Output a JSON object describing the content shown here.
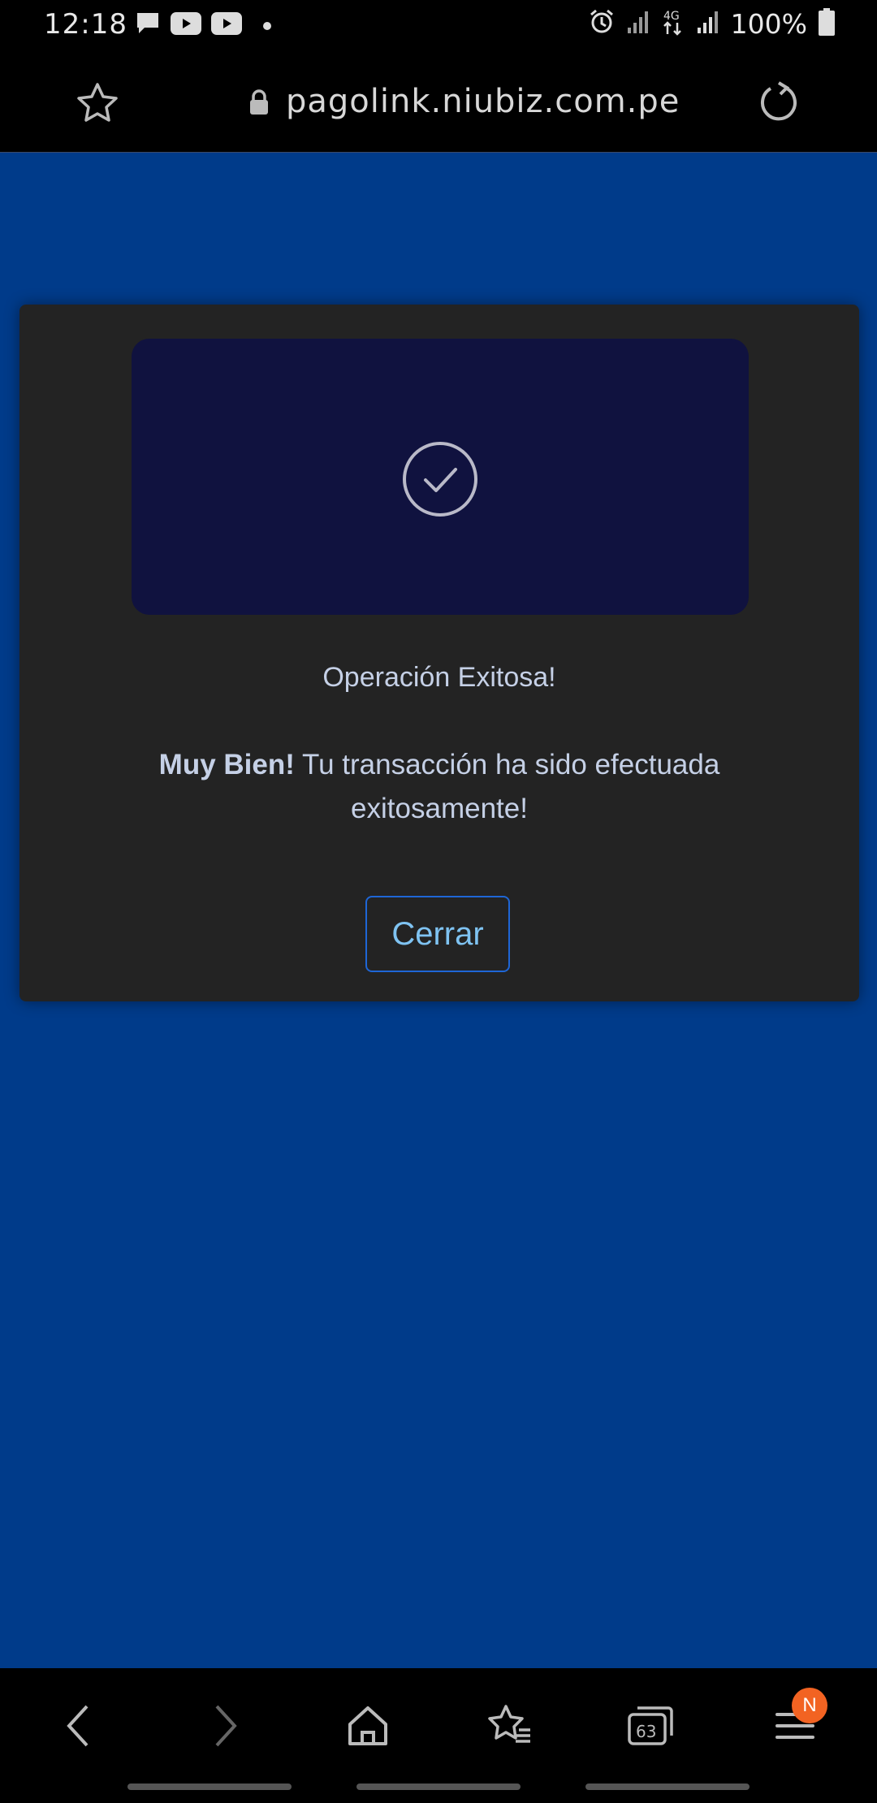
{
  "status_bar": {
    "time": "12:18",
    "battery": "100%",
    "network": "4G",
    "left_icons": [
      "message-icon",
      "youtube-icon",
      "youtube-icon"
    ],
    "right_icons": [
      "alarm-icon",
      "signal-icon",
      "data-4g-icon",
      "signal-icon",
      "battery-icon"
    ]
  },
  "browser": {
    "url": "pagolink.niubiz.com.pe",
    "tab_count": "63",
    "menu_badge": "N"
  },
  "dialog": {
    "title": "Operación Exitosa!",
    "message_bold": "Muy Bien!",
    "message_rest": " Tu transacción ha sido efectuada exitosamente!",
    "close_label": "Cerrar"
  },
  "colors": {
    "page_bg": "#003b8a",
    "dialog_bg": "#232323",
    "banner_bg": "#10123f",
    "button_border": "#1e66d6",
    "button_text": "#7fc3f2",
    "badge": "#f26322"
  }
}
